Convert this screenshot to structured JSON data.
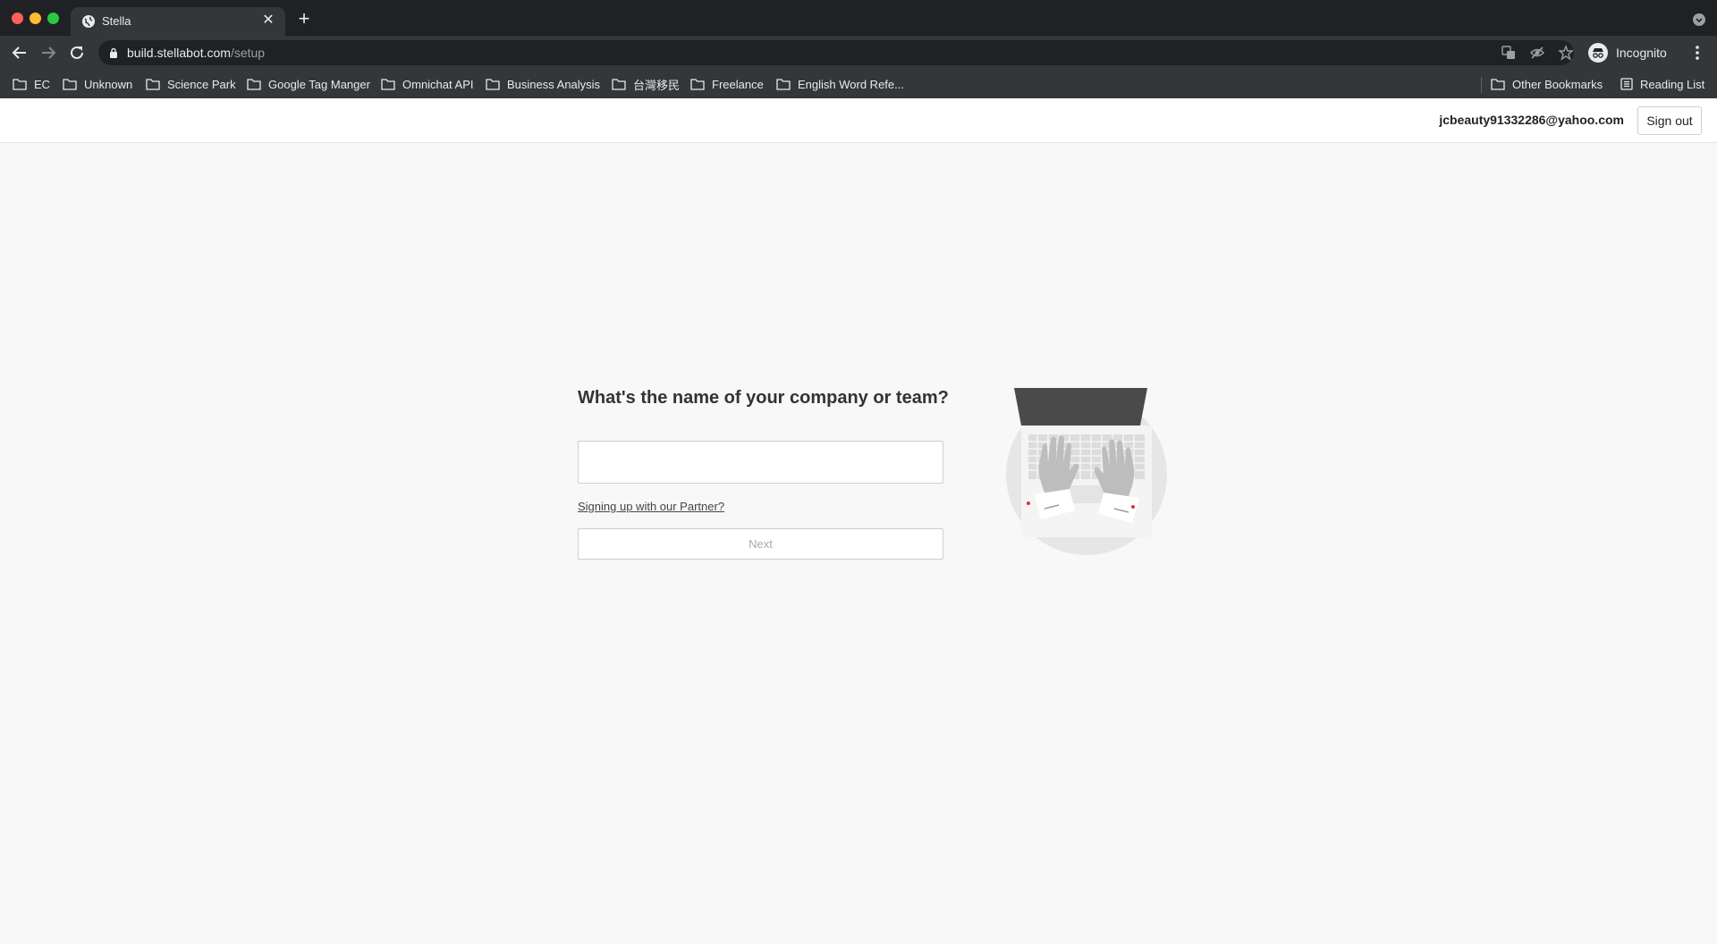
{
  "browser": {
    "tab_title": "Stella",
    "url_host": "build.stellabot.com",
    "url_path": "/setup",
    "profile_label": "Incognito",
    "bookmarks": [
      "EC",
      "Unknown",
      "Science Park",
      "Google Tag Manger",
      "Omnichat API",
      "Business Analysis",
      "台灣移民",
      "Freelance",
      "English Word Refe..."
    ],
    "other_bookmarks": "Other Bookmarks",
    "reading_list": "Reading List"
  },
  "header": {
    "user_email": "jcbeauty91332286@yahoo.com",
    "signout_label": "Sign out"
  },
  "setup": {
    "question": "What's the name of your company or team?",
    "company_input_value": "",
    "partner_link": "Signing up with our Partner?",
    "next_label": "Next"
  },
  "colors": {
    "chrome_dark": "#202124",
    "chrome_toolbar": "#35363a",
    "page_bg": "#f8f8f8",
    "illustration_accent": "#e0313c"
  }
}
